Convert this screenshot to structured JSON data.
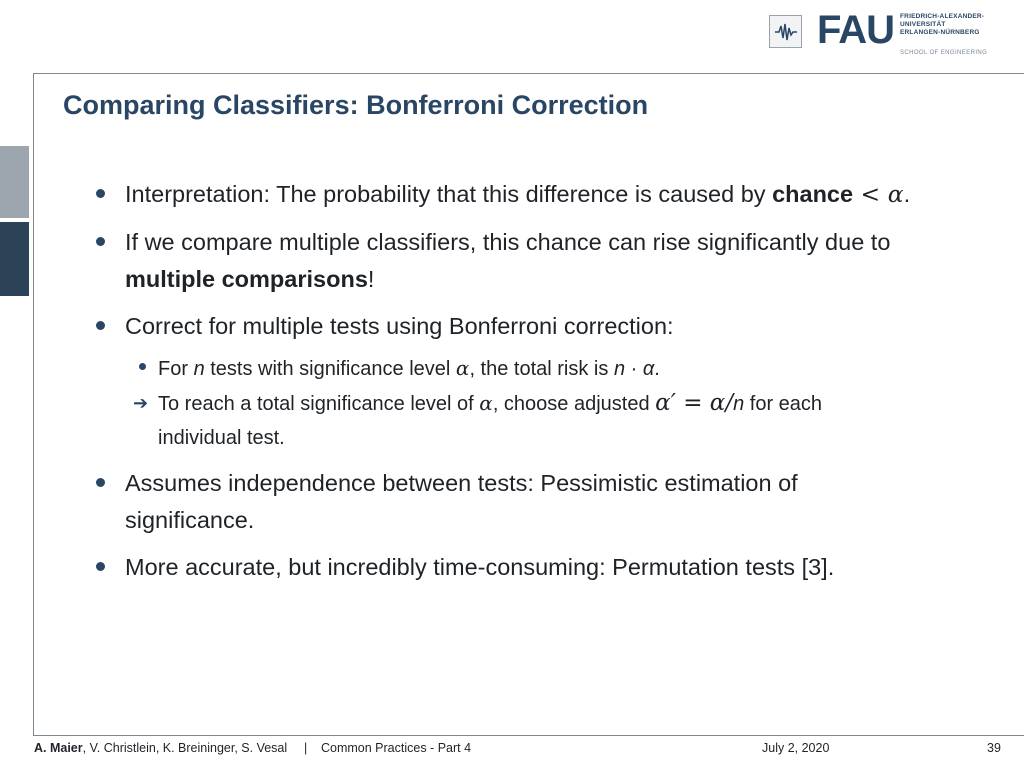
{
  "header": {
    "logo_word": "FAU",
    "univ_lines": [
      "FRIEDRICH-ALEXANDER-",
      "UNIVERSITÄT",
      "ERLANGEN-NÜRNBERG"
    ],
    "school": "SCHOOL OF ENGINEERING"
  },
  "slide": {
    "title": "Comparing Classifiers: Bonferroni Correction",
    "b1": {
      "text": "Interpretation: The probability that this difference is caused by ",
      "bold": "chance",
      "math": " < α",
      "end": "."
    },
    "b2": {
      "text": "If we compare multiple classifiers, this chance can rise significantly due to",
      "bold": "multiple comparisons",
      "end": "!"
    },
    "b3": {
      "text": "Correct for multiple tests using Bonferroni correction:"
    },
    "s1": {
      "pre": "For ",
      "n": "n",
      "mid": " tests with significance level ",
      "alpha": "α",
      "mid2": ", the total risk is ",
      "expr": "n · α",
      "end": "."
    },
    "s2": {
      "pre": "To reach a total significance level of ",
      "alpha": "α",
      "mid": ", choose adjusted ",
      "expr": "α′ = α/",
      "n": "n",
      "end": " for each",
      "line2": "individual test."
    },
    "b4": {
      "text": "Assumes independence between tests: Pessimistic estimation of",
      "line2": "significance."
    },
    "b5": {
      "text": "More accurate, but incredibly time-consuming: Permutation tests [3]."
    }
  },
  "footer": {
    "lead_author": "A. Maier",
    "other_authors": ", V. Christlein, K. Breininger, S. Vesal",
    "separator": "|",
    "course": "Common Practices - Part 4",
    "date": "July 2, 2020",
    "page": "39"
  }
}
